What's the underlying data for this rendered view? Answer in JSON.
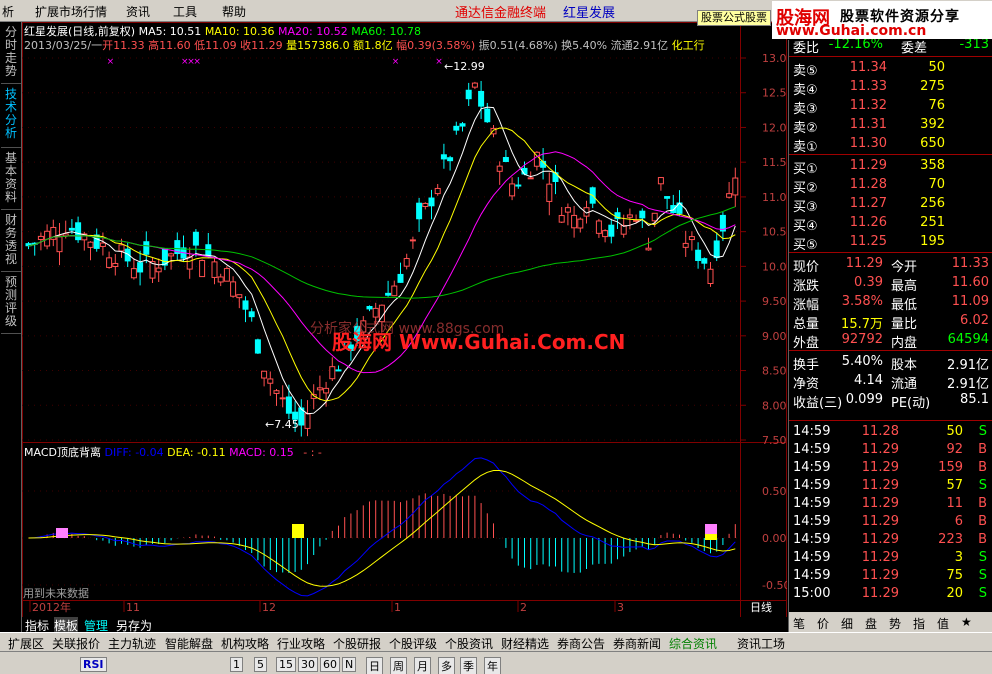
{
  "menu": {
    "items": [
      "析",
      "扩展市场行情",
      "资讯",
      "工具",
      "帮助"
    ],
    "brand": "通达信金融终端",
    "stock": "红星发展",
    "logo_button": "股票公式股票",
    "logo_main": "股海网",
    "logo_sub": "股票软件资源分享",
    "logo_url": "www.Guhai.com.cn"
  },
  "left_tabs": [
    "分时走势",
    "技术分析",
    "基本资料",
    "财务透视",
    "预测评级"
  ],
  "header": {
    "title": "红星发展(日线,前复权)",
    "ma5": "MA5: 10.51",
    "ma10": "MA10: 10.36",
    "ma20": "MA20: 10.52",
    "ma60": "MA60: 10.78",
    "date": "2013/03/25/一",
    "open": "开11.33",
    "high": "高11.60",
    "low": "低11.09",
    "close": "收11.29",
    "vol": "量157386.0",
    "amount": "额1.8亿",
    "change": "幅0.39(3.58%)",
    "amplitude": "振0.51(4.68%)",
    "turnover": "换5.40%",
    "float": "流通2.91亿",
    "industry": "化工行"
  },
  "annotations": {
    "high_mark": "12.99",
    "low_mark": "7.45",
    "watermark1": "分析家公式网 www.88gs.com",
    "watermark2": "股海网 Www.Guhai.Com.CN",
    "future_data": "用到未来数据"
  },
  "macd": {
    "title": "MACD顶底背离",
    "diff": "DIFF: -0.04",
    "dea": "DEA: -0.11",
    "macd": "MACD: 0.15",
    "extra": "- : -",
    "axis": [
      "0.50",
      "0.00",
      "-0.50"
    ]
  },
  "price_axis": [
    "13.00",
    "12.50",
    "12.00",
    "11.50",
    "11.00",
    "10.50",
    "10.00",
    "9.50",
    "9.00",
    "8.50",
    "8.00",
    "7.50"
  ],
  "time_axis": [
    "2012年",
    "11",
    "12",
    "1",
    "2",
    "3"
  ],
  "panel": {
    "top_row": {
      "l1": "委比",
      "v1": "-12.16%",
      "l2": "委差",
      "v2": "-313"
    },
    "sell": [
      {
        "label": "卖⑤",
        "price": "11.34",
        "vol": "50"
      },
      {
        "label": "卖④",
        "price": "11.33",
        "vol": "275"
      },
      {
        "label": "卖③",
        "price": "11.32",
        "vol": "76"
      },
      {
        "label": "卖②",
        "price": "11.31",
        "vol": "392"
      },
      {
        "label": "卖①",
        "price": "11.30",
        "vol": "650"
      }
    ],
    "buy": [
      {
        "label": "买①",
        "price": "11.29",
        "vol": "358"
      },
      {
        "label": "买②",
        "price": "11.28",
        "vol": "70"
      },
      {
        "label": "买③",
        "price": "11.27",
        "vol": "256"
      },
      {
        "label": "买④",
        "price": "11.26",
        "vol": "251"
      },
      {
        "label": "买⑤",
        "price": "11.25",
        "vol": "195"
      }
    ],
    "stats": [
      {
        "l1": "现价",
        "v1": "11.29",
        "l2": "今开",
        "v2": "11.33"
      },
      {
        "l1": "涨跌",
        "v1": "0.39",
        "l2": "最高",
        "v2": "11.60"
      },
      {
        "l1": "涨幅",
        "v1": "3.58%",
        "l2": "最低",
        "v2": "11.09"
      },
      {
        "l1": "总量",
        "v1": "15.7万",
        "l2": "量比",
        "v2": "6.02"
      },
      {
        "l1": "外盘",
        "v1": "92792",
        "l2": "内盘",
        "v2": "64594"
      }
    ],
    "fund": [
      {
        "l1": "换手",
        "v1": "5.40%",
        "l2": "股本",
        "v2": "2.91亿"
      },
      {
        "l1": "净资",
        "v1": "4.14",
        "l2": "流通",
        "v2": "2.91亿"
      },
      {
        "l1": "收益(三)",
        "v1": "0.099",
        "l2": "PE(动)",
        "v2": "85.1"
      }
    ],
    "ticks": [
      {
        "t": "14:59",
        "p": "11.28",
        "v": "50",
        "s": "S"
      },
      {
        "t": "14:59",
        "p": "11.29",
        "v": "92",
        "s": "B"
      },
      {
        "t": "14:59",
        "p": "11.29",
        "v": "159",
        "s": "B"
      },
      {
        "t": "14:59",
        "p": "11.29",
        "v": "57",
        "s": "S"
      },
      {
        "t": "14:59",
        "p": "11.29",
        "v": "11",
        "s": "B"
      },
      {
        "t": "14:59",
        "p": "11.29",
        "v": "6",
        "s": "B"
      },
      {
        "t": "14:59",
        "p": "11.29",
        "v": "223",
        "s": "B"
      },
      {
        "t": "14:59",
        "p": "11.29",
        "v": "3",
        "s": "S"
      },
      {
        "t": "14:59",
        "p": "11.29",
        "v": "75",
        "s": "S"
      },
      {
        "t": "15:00",
        "p": "11.29",
        "v": "20",
        "s": "S"
      }
    ],
    "period_label": "日线",
    "bottom_tabs": [
      "笔",
      "价",
      "细",
      "盘",
      "势",
      "指",
      "值",
      "★"
    ]
  },
  "chart_tabs": [
    "指标",
    "模板",
    "管理",
    "另存为"
  ],
  "bottom_bar": [
    "扩展区",
    "关联报价",
    "主力轨迹",
    "智能解盘",
    "机构攻略",
    "行业攻略",
    "个股研报",
    "个股评级",
    "个股资讯",
    "财经精选",
    "券商公告",
    "券商新闻",
    "综合资讯",
    "资讯工场"
  ],
  "status_bar": [
    "RSI",
    "1",
    "5",
    "15",
    "30",
    "60",
    "N",
    "日",
    "周",
    "月",
    "多",
    "季",
    "年"
  ],
  "colors": {
    "up": "#ff5050",
    "down": "#00ffff",
    "ma5": "#ffffff",
    "ma10": "#ffff00",
    "ma20": "#ff00ff",
    "ma60": "#00c000",
    "grid": "#800000"
  }
}
